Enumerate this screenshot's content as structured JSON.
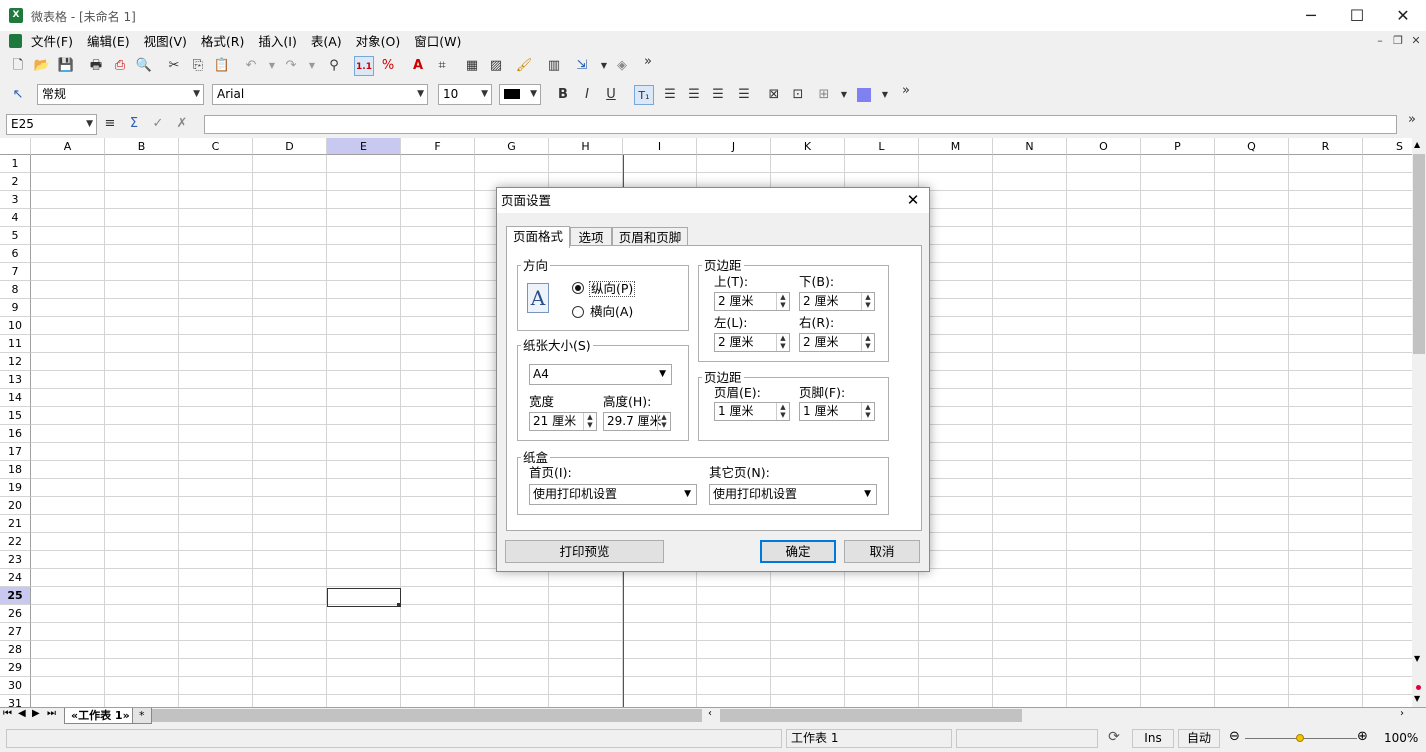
{
  "window": {
    "title": "微表格 - [未命名 1]"
  },
  "menu": [
    "文件(F)",
    "编辑(E)",
    "视图(V)",
    "格式(R)",
    "插入(I)",
    "表(A)",
    "对象(O)",
    "窗口(W)"
  ],
  "format_bar": {
    "style": "常规",
    "font": "Arial",
    "size": "10"
  },
  "formula_bar": {
    "cell_ref": "E25",
    "content": ""
  },
  "columns": [
    "A",
    "B",
    "C",
    "D",
    "E",
    "F",
    "G",
    "H",
    "I",
    "J",
    "K",
    "L",
    "M",
    "N",
    "O",
    "P",
    "Q",
    "R",
    "S"
  ],
  "rows": [
    "1",
    "2",
    "3",
    "4",
    "5",
    "6",
    "7",
    "8",
    "9",
    "10",
    "11",
    "12",
    "13",
    "14",
    "15",
    "16",
    "17",
    "18",
    "19",
    "20",
    "21",
    "22",
    "23",
    "24",
    "25",
    "26",
    "27",
    "28",
    "29",
    "30",
    "31"
  ],
  "selected_cell": {
    "column": "E",
    "row": "25"
  },
  "dialog": {
    "title": "页面设置",
    "tabs": [
      "页面格式",
      "选项",
      "页眉和页脚"
    ],
    "orientation": {
      "label": "方向",
      "portrait": "纵向(P)",
      "landscape": "横向(A)",
      "selected": "portrait"
    },
    "paper": {
      "label": "纸张大小(S)",
      "size": "A4",
      "width_label": "宽度",
      "width": "21 厘米",
      "height_label": "高度(H):",
      "height": "29.7 厘米"
    },
    "margins": {
      "label": "页边距",
      "top_label": "上(T):",
      "top": "2 厘米",
      "bottom_label": "下(B):",
      "bottom": "2 厘米",
      "left_label": "左(L):",
      "left": "2 厘米",
      "right_label": "右(R):",
      "right": "2 厘米"
    },
    "header_footer": {
      "label": "页边距",
      "header_label": "页眉(E):",
      "header": "1 厘米",
      "footer_label": "页脚(F):",
      "footer": "1 厘米"
    },
    "tray": {
      "label": "纸盒",
      "first_label": "首页(I):",
      "first": "使用打印机设置",
      "other_label": "其它页(N):",
      "other": "使用打印机设置"
    },
    "buttons": {
      "preview": "打印预览",
      "ok": "确定",
      "cancel": "取消"
    }
  },
  "sheet_tabs": {
    "active": "«工作表 1»",
    "add": "*"
  },
  "status": {
    "sheet": "工作表 1",
    "ins": "Ins",
    "mode": "自动",
    "zoom": "100%"
  }
}
